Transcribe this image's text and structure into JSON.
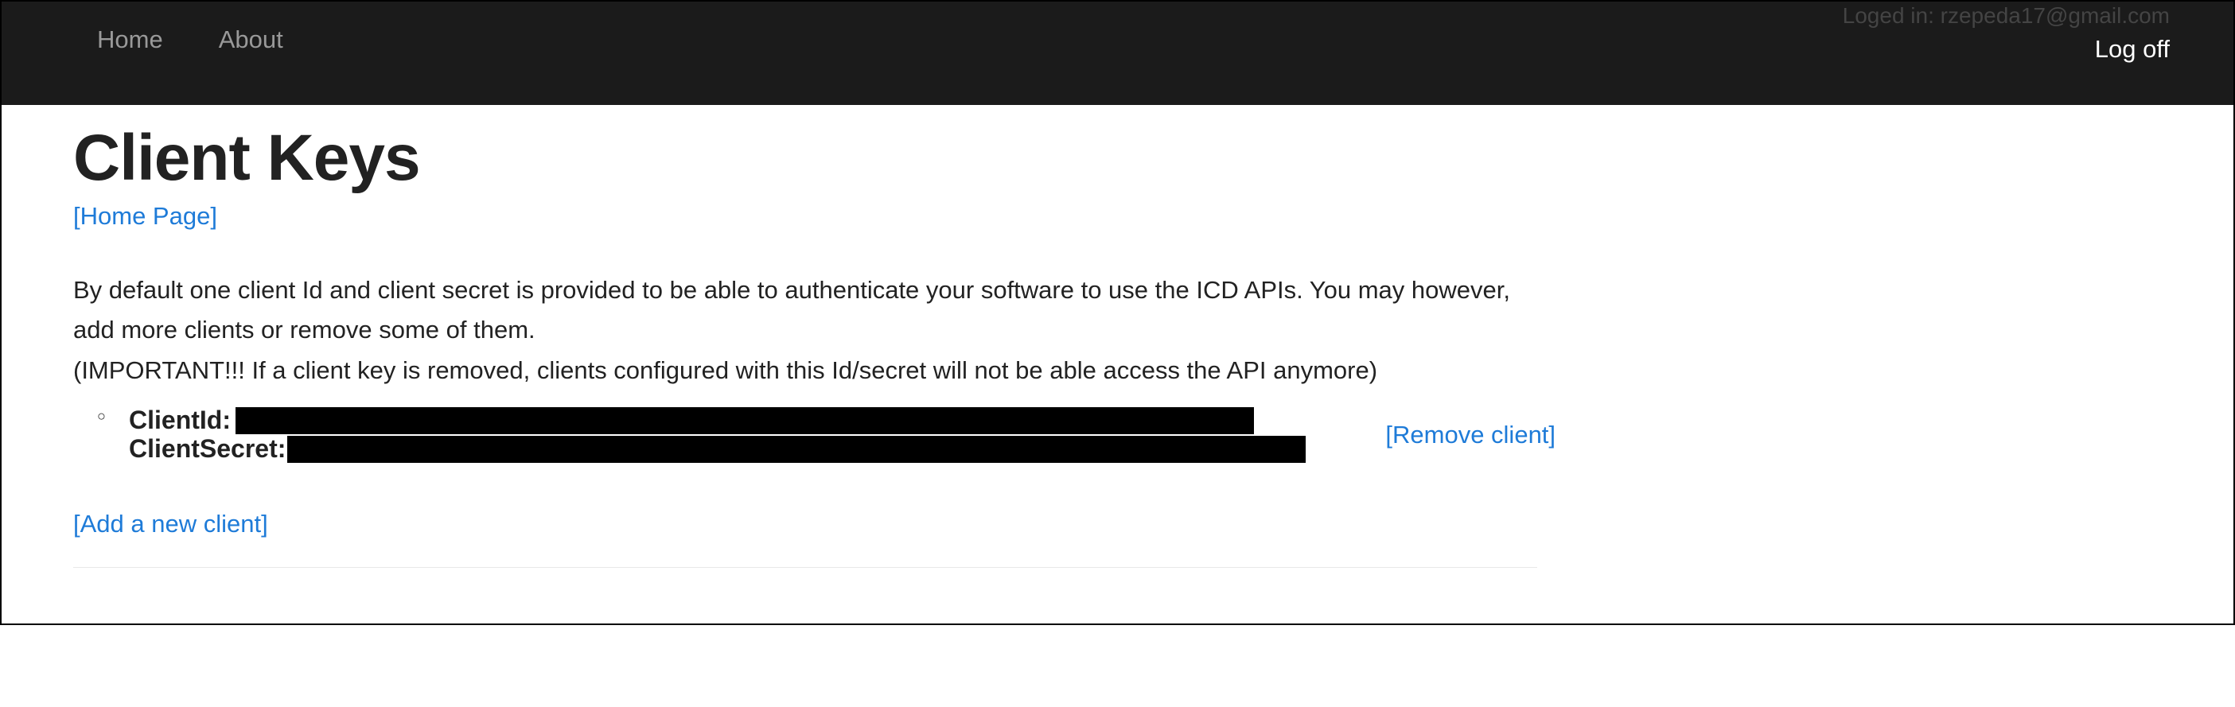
{
  "navbar": {
    "home": "Home",
    "about": "About",
    "logged_in": "Loged in: rzepeda17@gmail.com",
    "logoff": "Log off"
  },
  "page": {
    "title": "Client Keys",
    "home_link": "[Home Page]",
    "description_1": "By default one client Id and client secret is provided to be able to authenticate your software to use the ICD APIs. You may however, add more clients or remove some of them.",
    "description_2": "(IMPORTANT!!! If a client key is removed, clients configured with this Id/secret will not be able access the API anymore)"
  },
  "client": {
    "client_id_label": "ClientId:",
    "client_secret_label": "ClientSecret:",
    "remove_link": "[Remove client]"
  },
  "actions": {
    "add_client": "[Add a new client]"
  }
}
